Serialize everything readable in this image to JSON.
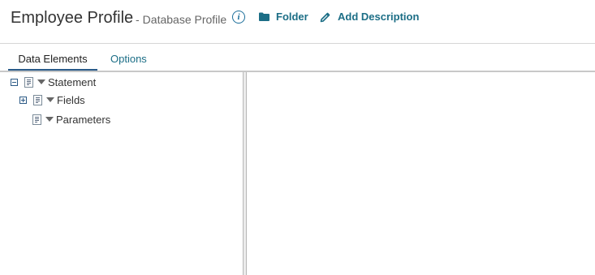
{
  "header": {
    "title": "Employee Profile",
    "subtitle_prefix": "-",
    "subtitle": "Database Profile",
    "info_icon": "i",
    "actions": {
      "folder_label": "Folder",
      "add_description_label": "Add Description"
    }
  },
  "tabs": [
    {
      "label": "Data Elements",
      "active": true
    },
    {
      "label": "Options",
      "active": false
    }
  ],
  "tree": [
    {
      "label": "Statement",
      "expanded": true,
      "icon": "document-icon"
    },
    {
      "label": "Fields",
      "expanded": false,
      "icon": "document-icon"
    },
    {
      "label": "Parameters",
      "icon": "document-icon"
    }
  ],
  "colors": {
    "accent": "#1c6e86",
    "active_tab_underline": "#2a5b8a",
    "text": "#333333",
    "muted_text": "#666666"
  }
}
